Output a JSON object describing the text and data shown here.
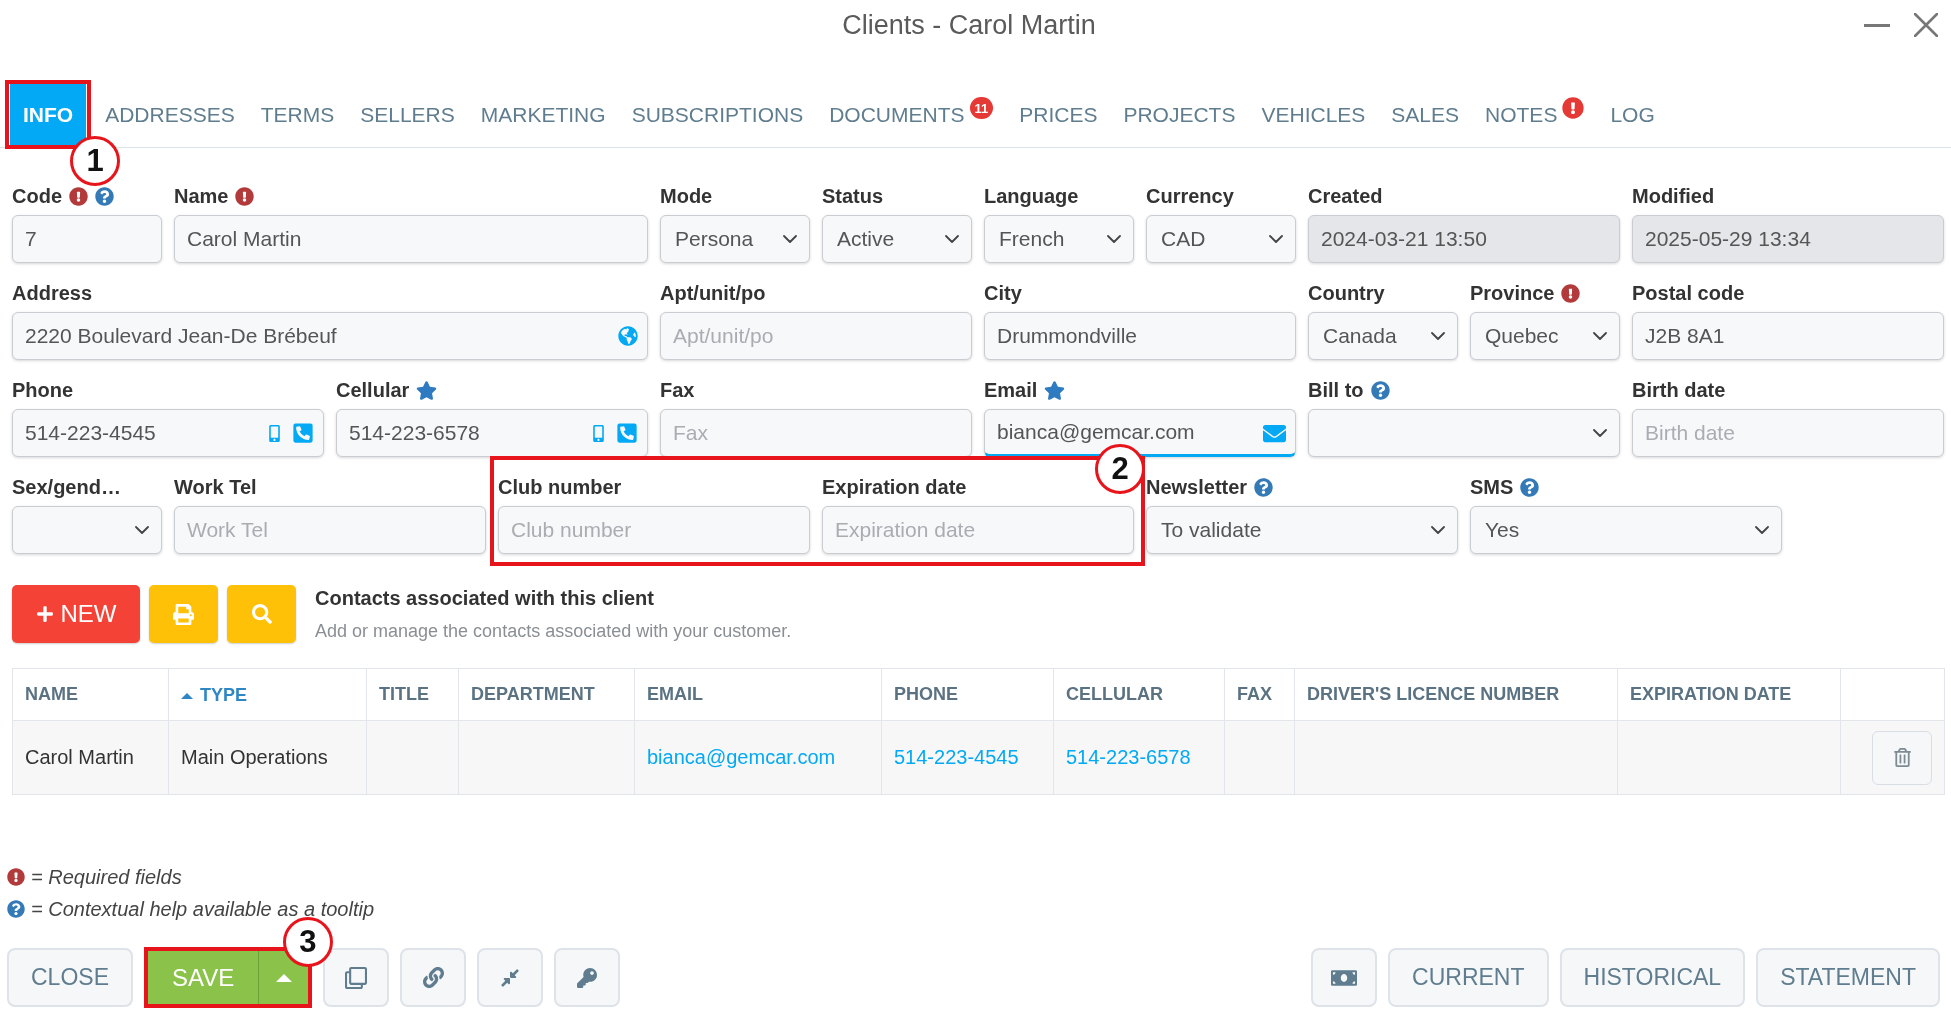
{
  "window": {
    "title": "Clients - Carol Martin"
  },
  "tabs": [
    {
      "label": "INFO",
      "selected": true,
      "alert": false,
      "callout": "1"
    },
    {
      "label": "ADDRESSES",
      "selected": false,
      "alert": false
    },
    {
      "label": "TERMS",
      "selected": false,
      "alert": false
    },
    {
      "label": "SELLERS",
      "selected": false,
      "alert": false
    },
    {
      "label": "MARKETING",
      "selected": false,
      "alert": false
    },
    {
      "label": "SUBSCRIPTIONS",
      "selected": false,
      "alert": false
    },
    {
      "label": "DOCUMENTS",
      "selected": false,
      "alert": false,
      "badge": "11"
    },
    {
      "label": "PRICES",
      "selected": false,
      "alert": false
    },
    {
      "label": "PROJECTS",
      "selected": false,
      "alert": false
    },
    {
      "label": "VEHICLES",
      "selected": false,
      "alert": false
    },
    {
      "label": "SALES",
      "selected": false,
      "alert": false
    },
    {
      "label": "NOTES",
      "selected": false,
      "alert": true
    },
    {
      "label": "LOG",
      "selected": false,
      "alert": false
    }
  ],
  "form": {
    "rows": [
      {
        "fields": [
          {
            "label": "Code",
            "kind": "text",
            "value": "7",
            "required": true,
            "help": true,
            "starred": false,
            "disabled": false,
            "focused": false
          },
          {
            "label": "Name",
            "kind": "text",
            "value": "Carol Martin",
            "required": true,
            "help": false,
            "starred": false,
            "disabled": false,
            "focused": false
          },
          {
            "label": "Mode",
            "kind": "select",
            "value": "Persona",
            "required": false,
            "help": false,
            "starred": false,
            "disabled": false,
            "focused": false
          },
          {
            "label": "Status",
            "kind": "select",
            "value": "Active",
            "required": false,
            "help": false,
            "starred": false,
            "disabled": false,
            "focused": false
          },
          {
            "label": "Language",
            "kind": "select",
            "value": "French",
            "required": false,
            "help": false,
            "starred": false,
            "disabled": false,
            "focused": false
          },
          {
            "label": "Currency",
            "kind": "select",
            "value": "CAD",
            "required": false,
            "help": false,
            "starred": false,
            "disabled": false,
            "focused": false
          },
          {
            "label": "Created",
            "kind": "text",
            "value": "2024-03-21 13:50",
            "required": false,
            "help": false,
            "starred": false,
            "disabled": true,
            "focused": false
          },
          {
            "label": "Modified",
            "kind": "text",
            "value": "2025-05-29 13:34",
            "required": false,
            "help": false,
            "starred": false,
            "disabled": true,
            "focused": false
          }
        ]
      },
      {
        "fields": [
          {
            "label": "Address",
            "kind": "address",
            "value": "2220 Boulevard Jean-De Brébeuf",
            "required": false,
            "help": false,
            "starred": false,
            "disabled": false,
            "focused": false
          },
          {
            "label": "Apt/unit/po",
            "kind": "text",
            "placeholder": "Apt/unit/po",
            "required": false,
            "help": false,
            "starred": false,
            "disabled": false,
            "focused": false
          },
          {
            "label": "City",
            "kind": "text",
            "value": "Drummondville",
            "required": false,
            "help": false,
            "starred": false,
            "disabled": false,
            "focused": false
          },
          {
            "label": "Country",
            "kind": "select",
            "value": "Canada",
            "required": false,
            "help": false,
            "starred": false,
            "disabled": false,
            "focused": false
          },
          {
            "label": "Province",
            "kind": "select",
            "value": "Quebec",
            "required": true,
            "help": false,
            "starred": false,
            "disabled": false,
            "focused": false
          },
          {
            "label": "Postal code",
            "kind": "text",
            "value": "J2B 8A1",
            "required": false,
            "help": false,
            "starred": false,
            "disabled": false,
            "focused": false
          }
        ]
      },
      {
        "fields": [
          {
            "label": "Phone",
            "kind": "phone",
            "value": "514-223-4545",
            "required": false,
            "help": false,
            "starred": false,
            "disabled": false,
            "focused": false
          },
          {
            "label": "Cellular",
            "kind": "phone",
            "value": "514-223-6578",
            "required": false,
            "help": false,
            "starred": true,
            "disabled": false,
            "focused": false
          },
          {
            "label": "Fax",
            "kind": "text",
            "placeholder": "Fax",
            "required": false,
            "help": false,
            "starred": false,
            "disabled": false,
            "focused": false
          },
          {
            "label": "Email",
            "kind": "email",
            "value": "bianca@gemcar.com",
            "required": false,
            "help": false,
            "starred": true,
            "disabled": false,
            "focused": true
          },
          {
            "label": "Bill to",
            "kind": "select",
            "required": false,
            "help": true,
            "starred": false,
            "disabled": false,
            "focused": false
          },
          {
            "label": "Birth date",
            "kind": "text",
            "placeholder": "Birth date",
            "required": false,
            "help": false,
            "starred": false,
            "disabled": false,
            "focused": false
          }
        ]
      },
      {
        "fields": [
          {
            "label": "Sex/gend…",
            "kind": "select",
            "required": false,
            "help": false,
            "starred": false,
            "disabled": false,
            "focused": false
          },
          {
            "label": "Work Tel",
            "kind": "text",
            "placeholder": "Work Tel",
            "required": false,
            "help": false,
            "starred": false,
            "disabled": false,
            "focused": false
          },
          {
            "kind": "group",
            "callout": "2",
            "fields": [
              {
                "label": "Club number",
                "kind": "text",
                "placeholder": "Club number",
                "required": false,
                "help": false,
                "starred": false,
                "disabled": false,
                "focused": false
              },
              {
                "label": "Expiration date",
                "kind": "text",
                "placeholder": "Expiration date",
                "required": false,
                "help": false,
                "starred": false,
                "disabled": false,
                "focused": false
              }
            ]
          },
          {
            "label": "Newsletter",
            "kind": "select",
            "value": "To validate",
            "required": false,
            "help": true,
            "starred": false,
            "disabled": false,
            "focused": false
          },
          {
            "label": "SMS",
            "kind": "select",
            "value": "Yes",
            "required": false,
            "help": true,
            "starred": false,
            "disabled": false,
            "focused": false
          }
        ]
      }
    ]
  },
  "contacts": {
    "new_button": "NEW",
    "title": "Contacts associated with this client",
    "subtitle": "Add or manage the contacts associated with your customer."
  },
  "table": {
    "columns": [
      {
        "label": "NAME",
        "sorted": false
      },
      {
        "label": "TYPE",
        "sorted": true
      },
      {
        "label": "TITLE",
        "sorted": false
      },
      {
        "label": "DEPARTMENT",
        "sorted": false
      },
      {
        "label": "EMAIL",
        "sorted": false
      },
      {
        "label": "PHONE",
        "sorted": false
      },
      {
        "label": "CELLULAR",
        "sorted": false
      },
      {
        "label": "FAX",
        "sorted": false
      },
      {
        "label": "DRIVER'S LICENCE NUMBER",
        "sorted": false
      },
      {
        "label": "EXPIRATION DATE",
        "sorted": false
      }
    ],
    "rows": [
      {
        "cells": [
          {
            "text": "Carol Martin",
            "link": false
          },
          {
            "text": "Main Operations",
            "link": false
          },
          {},
          {},
          {
            "text": "bianca@gemcar.com",
            "link": true
          },
          {
            "text": "514-223-4545",
            "link": true
          },
          {
            "text": "514-223-6578",
            "link": true
          },
          {},
          {},
          {}
        ]
      }
    ]
  },
  "legend": [
    {
      "kind": "required",
      "text": "= Required fields"
    },
    {
      "kind": "help",
      "text": "= Contextual help available as a tooltip"
    }
  ],
  "footer": {
    "close_button": "CLOSE",
    "save_button": {
      "label": "SAVE",
      "callout": "3"
    },
    "report_buttons": [
      "CURRENT",
      "HISTORICAL",
      "STATEMENT"
    ]
  }
}
